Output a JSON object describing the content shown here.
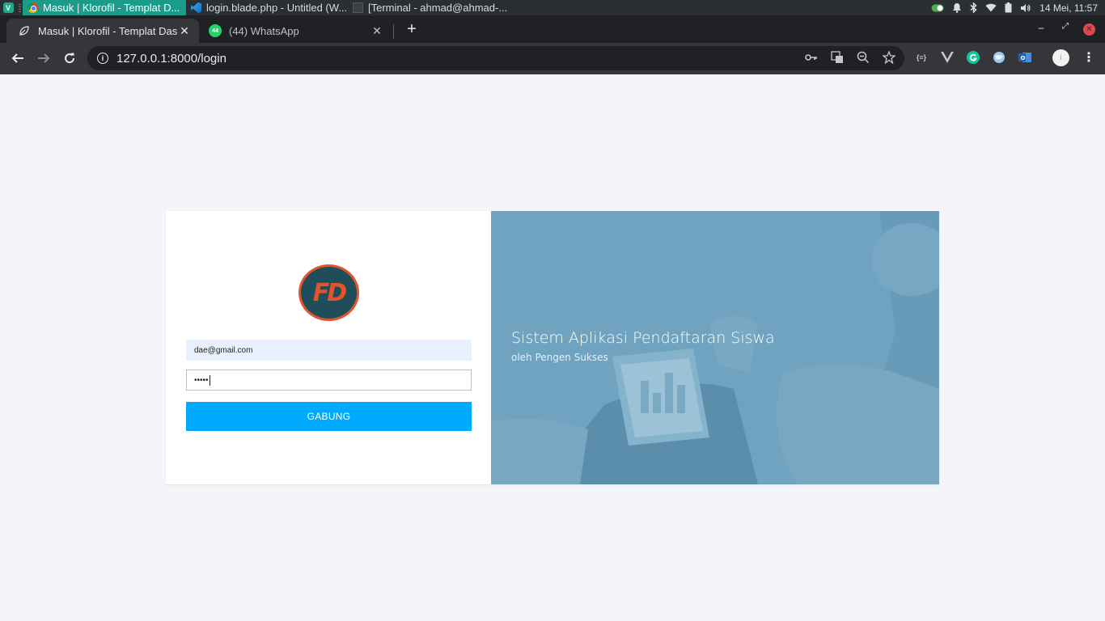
{
  "os": {
    "menu_letter": "V",
    "tasks": [
      {
        "title": "Masuk | Klorofil - Templat D...",
        "app": "chrome"
      },
      {
        "title": "login.blade.php - Untitled (W...",
        "app": "vscode"
      },
      {
        "title": "[Terminal - ahmad@ahmad-...",
        "app": "terminal"
      }
    ],
    "clock": "14 Mei, 11:57"
  },
  "browser": {
    "tabs": [
      {
        "title": "Masuk | Klorofil - Templat Dashb",
        "active": true
      },
      {
        "title": "(44) WhatsApp",
        "active": false,
        "badge": "44"
      }
    ],
    "url": "127.0.0.1:8000/login",
    "new_tab_label": "+",
    "profile_initial": "i"
  },
  "login": {
    "logo_text": "FD",
    "email_value": "dae@gmail.com",
    "password_mask": "•••••",
    "submit_label": "GABUNG"
  },
  "hero": {
    "title": "Sistem Aplikasi Pendaftaran Siswa",
    "subtitle": "oleh Pengen Sukses"
  },
  "colors": {
    "accent": "#00aaff",
    "hero_bg": "#6fa3c0",
    "page_bg": "#f3f5f8",
    "logo_orange": "#e2542b",
    "logo_dark": "#1f4d5a"
  }
}
